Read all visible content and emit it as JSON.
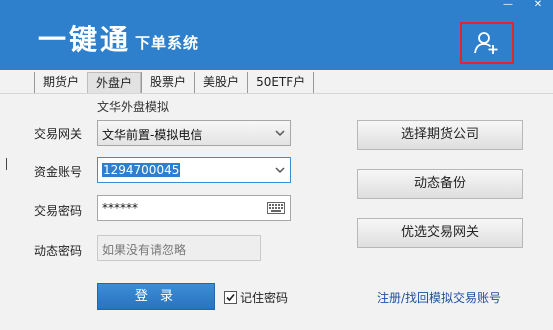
{
  "window": {
    "minimize_icon": "minimize-icon",
    "close_icon": "close-icon"
  },
  "header": {
    "title": "一键通",
    "subtitle": "下单系统",
    "add_user_icon": "user-add-icon"
  },
  "tabs": [
    {
      "label": "期货户",
      "active": false
    },
    {
      "label": "外盘户",
      "active": true
    },
    {
      "label": "股票户",
      "active": false
    },
    {
      "label": "美股户",
      "active": false
    },
    {
      "label": "50ETF户",
      "active": false
    }
  ],
  "form": {
    "mode_label": "文华外盘模拟",
    "gateway_label": "交易网关",
    "gateway_value": "文华前置-模拟电信",
    "account_label": "资金账号",
    "account_value": "1294700045",
    "password_label": "交易密码",
    "password_value": "******",
    "dynamic_label": "动态密码",
    "dynamic_placeholder": "如果没有请忽略",
    "login_label": "登 录",
    "remember_label": "记住密码",
    "remember_checked": true
  },
  "side_buttons": {
    "choose_company": "选择期货公司",
    "dynamic_backup": "动态备份",
    "preferred_gateway": "优选交易网关"
  },
  "register_link": "注册/找回模拟交易账号",
  "colors": {
    "header": "#2f80cc",
    "highlight_box": "#e0252b",
    "login_button": "#2f7fd0",
    "link": "#1d4f9e"
  }
}
